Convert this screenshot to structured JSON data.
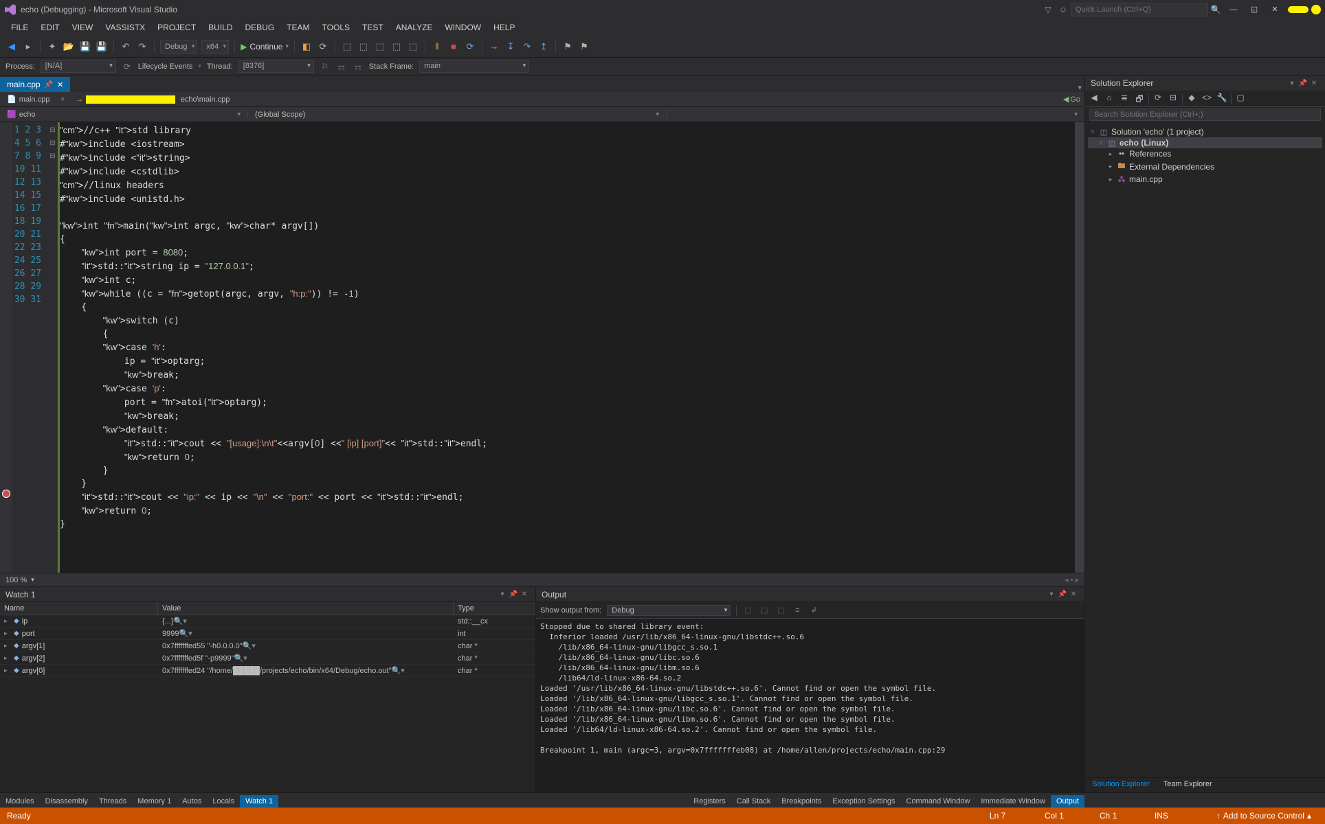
{
  "titlebar": {
    "title": "echo (Debugging) - Microsoft Visual Studio",
    "quick_launch_placeholder": "Quick Launch (Ctrl+Q)"
  },
  "menu": [
    "FILE",
    "EDIT",
    "VIEW",
    "VASSISTX",
    "PROJECT",
    "BUILD",
    "DEBUG",
    "TEAM",
    "TOOLS",
    "TEST",
    "ANALYZE",
    "WINDOW",
    "HELP"
  ],
  "toolbar": {
    "config": "Debug",
    "platform": "x64",
    "continue": "Continue"
  },
  "debugbar": {
    "process_label": "Process:",
    "process": "[N/A]",
    "lifecycle": "Lifecycle Events",
    "thread_label": "Thread:",
    "thread": "[8376]",
    "stack_label": "Stack Frame:",
    "stack": "main"
  },
  "tab": {
    "name": "main.cpp"
  },
  "navbar": {
    "left": "main.cpp",
    "breadcrumb_suffix": "echo\\main.cpp",
    "go": "Go"
  },
  "scopebar": {
    "left": "echo",
    "mid": "(Global Scope)",
    "right": ""
  },
  "code_lines": [
    "//c++ std library",
    "#include <iostream>",
    "#include <string>",
    "#include <cstdlib>",
    "//linux headers",
    "#include <unistd.h>",
    "",
    "int main(int argc, char* argv[])",
    "{",
    "    int port = 8080;",
    "    std::string ip = \"127.0.0.1\";",
    "    int c;",
    "    while ((c = getopt(argc, argv, \"h:p:\")) != -1)",
    "    {",
    "        switch (c)",
    "        {",
    "        case 'h':",
    "            ip = optarg;",
    "            break;",
    "        case 'p':",
    "            port = atoi(optarg);",
    "            break;",
    "        default:",
    "            std::cout << \"[usage]:\\n\\t\"<<argv[0] <<\" [ip] [port]\"<< std::endl;",
    "            return 0;",
    "        }",
    "    }",
    "    std::cout << \"ip:\" << ip << \"\\n\" << \"port:\" << port << std::endl;",
    "    return 0;",
    "}",
    ""
  ],
  "zoom": "100 %",
  "watch": {
    "title": "Watch 1",
    "columns": {
      "name": "Name",
      "value": "Value",
      "type": "Type"
    },
    "rows": [
      {
        "name": "ip",
        "value": "{...}",
        "type": "std::__cx"
      },
      {
        "name": "port",
        "value": "9999",
        "type": "int"
      },
      {
        "name": "argv[1]",
        "value": "0x7fffffffed55 \"-h0.0.0.0\"",
        "type": "char *"
      },
      {
        "name": "argv[2]",
        "value": "0x7fffffffed5f \"-p9999\"",
        "type": "char *"
      },
      {
        "name": "argv[0]",
        "value": "0x7fffffffed24 \"/home/█████/projects/echo/bin/x64/Debug/echo.out\"",
        "type": "char *"
      }
    ]
  },
  "output": {
    "title": "Output",
    "show_from_label": "Show output from:",
    "show_from": "Debug",
    "text": "Stopped due to shared library event:\n  Inferior loaded /usr/lib/x86_64-linux-gnu/libstdc++.so.6\n    /lib/x86_64-linux-gnu/libgcc_s.so.1\n    /lib/x86_64-linux-gnu/libc.so.6\n    /lib/x86_64-linux-gnu/libm.so.6\n    /lib64/ld-linux-x86-64.so.2\nLoaded '/usr/lib/x86_64-linux-gnu/libstdc++.so.6'. Cannot find or open the symbol file.\nLoaded '/lib/x86_64-linux-gnu/libgcc_s.so.1'. Cannot find or open the symbol file.\nLoaded '/lib/x86_64-linux-gnu/libc.so.6'. Cannot find or open the symbol file.\nLoaded '/lib/x86_64-linux-gnu/libm.so.6'. Cannot find or open the symbol file.\nLoaded '/lib64/ld-linux-x86-64.so.2'. Cannot find or open the symbol file.\n\nBreakpoint 1, main (argc=3, argv=0x7fffffffeb08) at /home/allen/projects/echo/main.cpp:29"
  },
  "bottom_tabs_left": [
    "Modules",
    "Disassembly",
    "Threads",
    "Memory 1",
    "Autos",
    "Locals",
    "Watch 1"
  ],
  "bottom_tabs_right": [
    "Registers",
    "Call Stack",
    "Breakpoints",
    "Exception Settings",
    "Command Window",
    "Immediate Window",
    "Output"
  ],
  "solution": {
    "title": "Solution Explorer",
    "search_placeholder": "Search Solution Explorer (Ctrl+;)",
    "root": "Solution 'echo' (1 project)",
    "project": "echo (Linux)",
    "refs": "References",
    "ext": "External Dependencies",
    "file": "main.cpp",
    "tabs": [
      "Solution Explorer",
      "Team Explorer"
    ]
  },
  "status": {
    "ready": "Ready",
    "ln": "Ln 7",
    "col": "Col 1",
    "ch": "Ch 1",
    "ins": "INS",
    "src": "Add to Source Control"
  }
}
